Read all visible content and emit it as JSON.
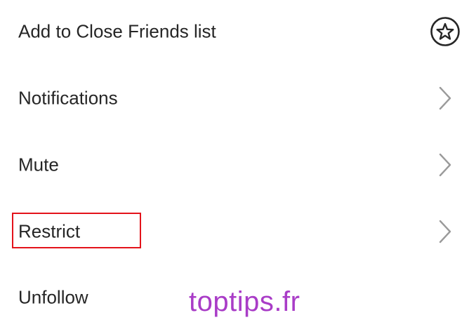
{
  "menu": {
    "items": [
      {
        "label": "Add to Close Friends list",
        "icon": "star-circle-icon"
      },
      {
        "label": "Notifications",
        "icon": "chevron-right-icon"
      },
      {
        "label": "Mute",
        "icon": "chevron-right-icon"
      },
      {
        "label": "Restrict",
        "icon": "chevron-right-icon"
      },
      {
        "label": "Unfollow",
        "icon": ""
      }
    ]
  },
  "annotation": {
    "highlight_color": "#e3131b",
    "highlighted_item": "Restrict"
  },
  "watermark": {
    "text": "toptips.fr",
    "color": "#a93cc7"
  },
  "colors": {
    "text": "#262626",
    "icon": "#9a9a9a",
    "star_icon": "#262626",
    "background": "#ffffff"
  }
}
